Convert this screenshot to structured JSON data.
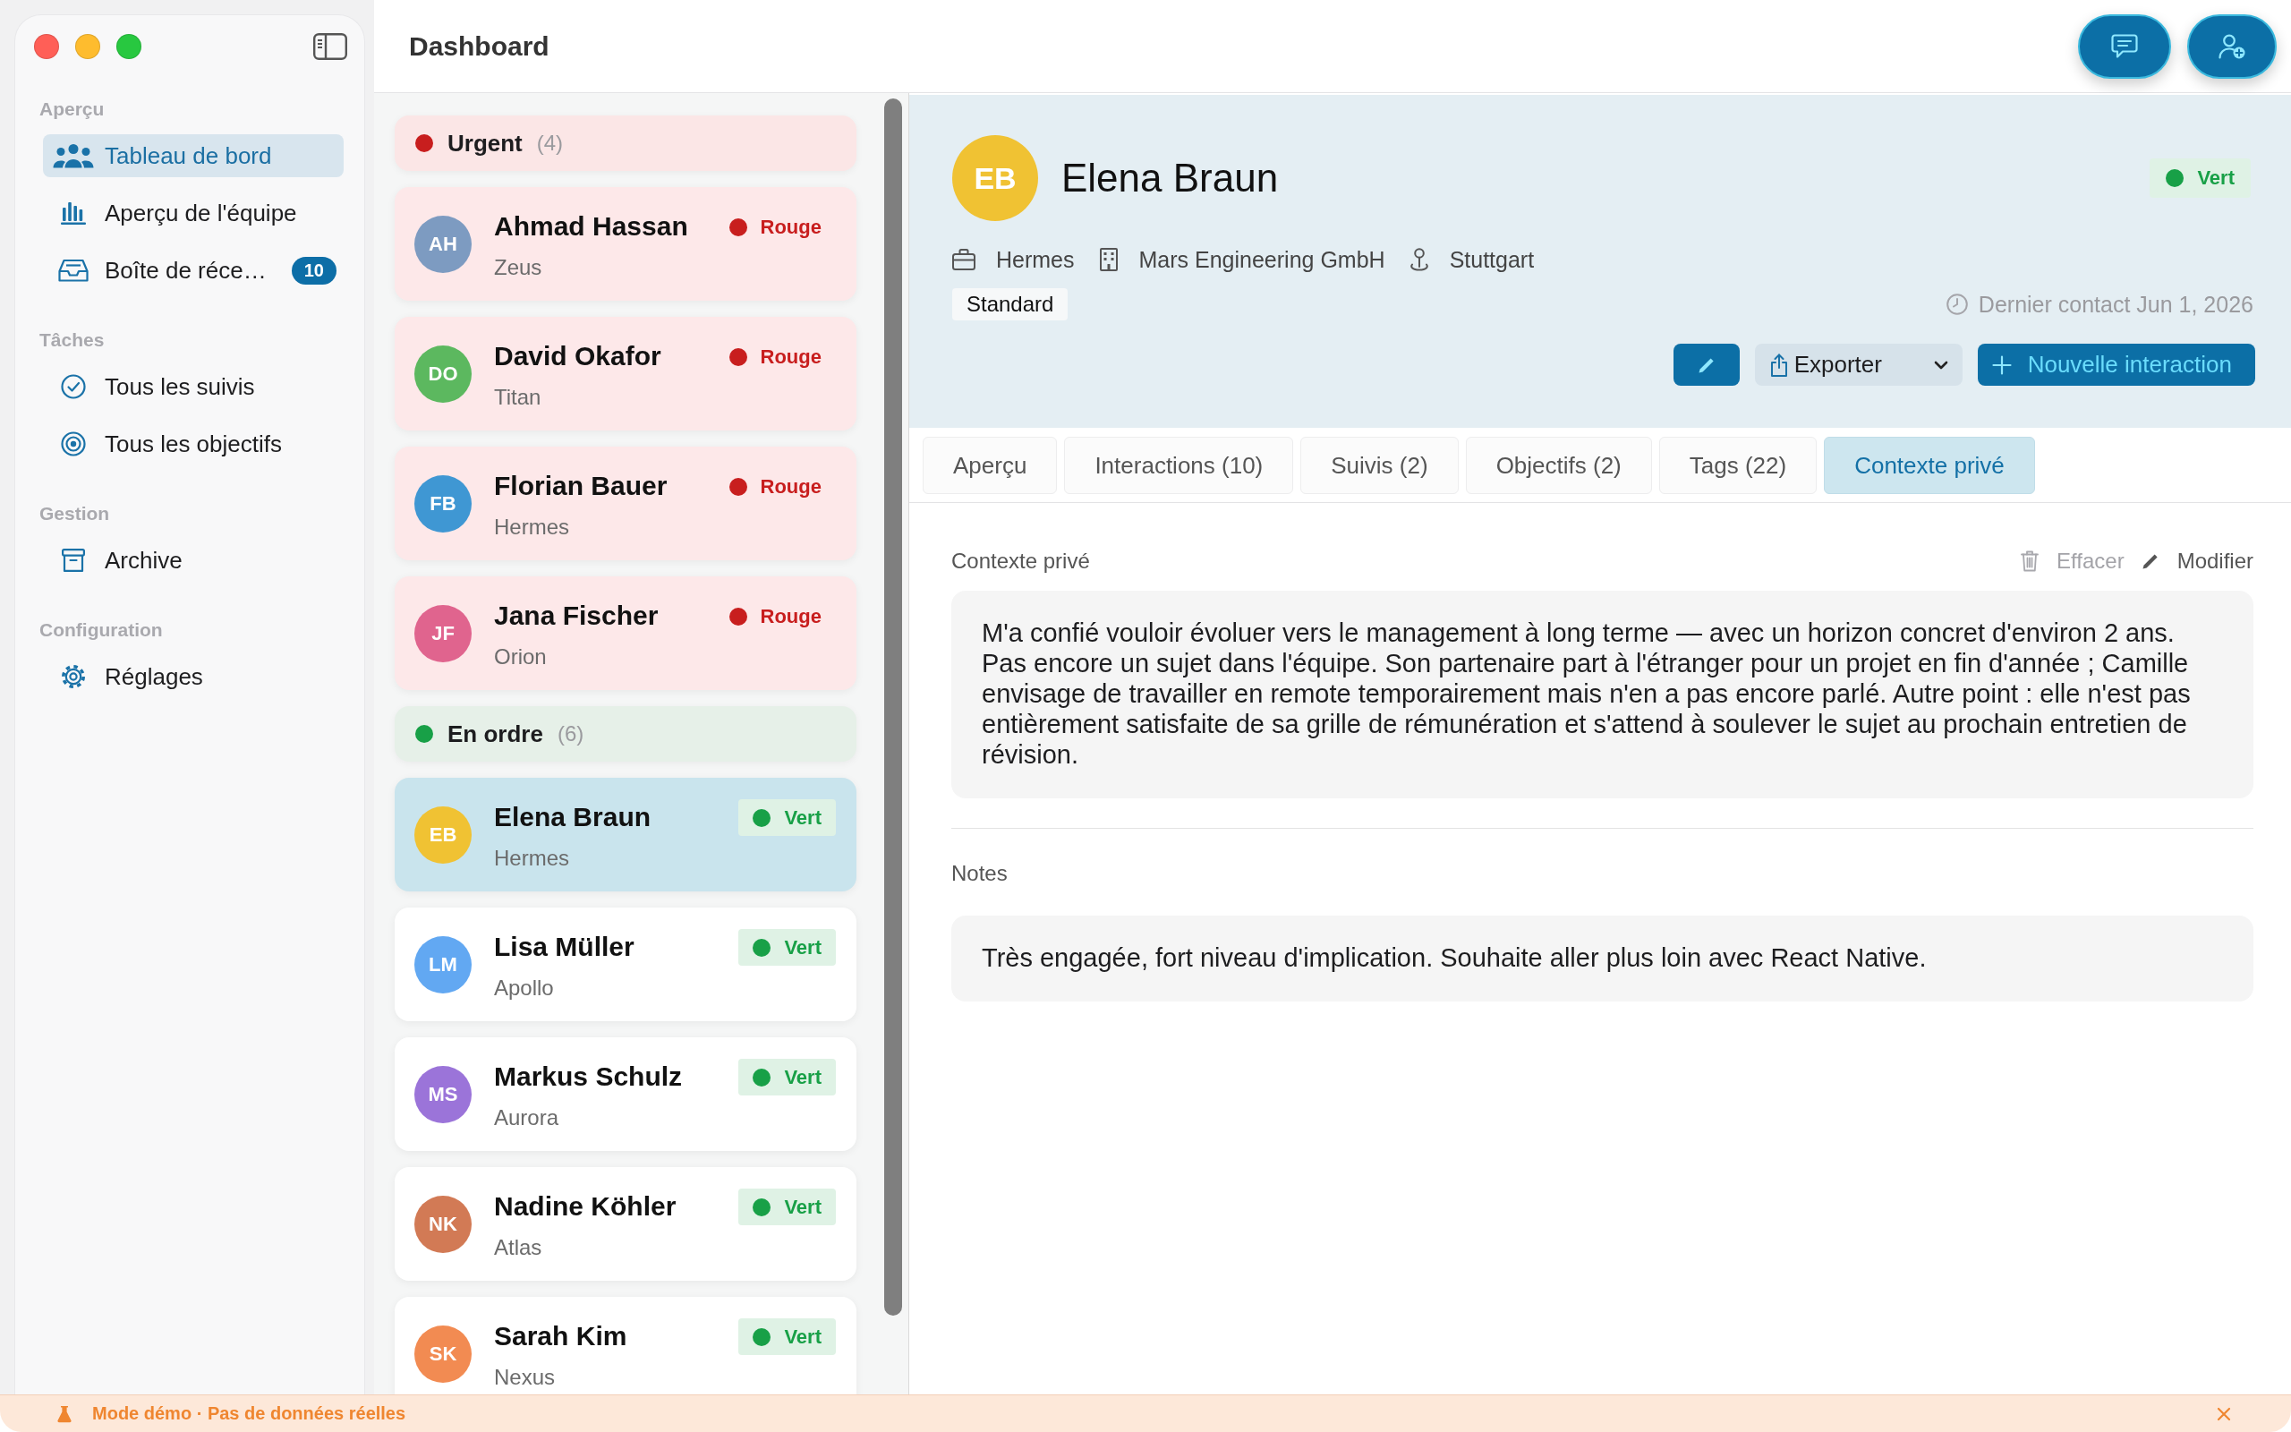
{
  "window": {
    "title": "Dashboard"
  },
  "sidebar": {
    "sections": [
      {
        "title": "Aperçu",
        "items": [
          {
            "label": "Tableau de bord",
            "selected": true
          },
          {
            "label": "Aperçu de l'équipe",
            "selected": false
          },
          {
            "label": "Boîte de réce…",
            "selected": false,
            "badge": "10"
          }
        ]
      },
      {
        "title": "Tâches",
        "items": [
          {
            "label": "Tous les suivis",
            "selected": false
          },
          {
            "label": "Tous les objectifs",
            "selected": false
          }
        ]
      },
      {
        "title": "Gestion",
        "items": [
          {
            "label": "Archive",
            "selected": false
          }
        ]
      },
      {
        "title": "Configuration",
        "items": [
          {
            "label": "Réglages",
            "selected": false
          }
        ]
      }
    ]
  },
  "contact_list": {
    "groups": [
      {
        "kind": "urgent",
        "label": "Urgent",
        "count": "(4)",
        "color": "#c81e1e",
        "contacts": [
          {
            "avatar": {
              "initials": "AH",
              "color": "#7d9bc1"
            },
            "name": "Ahmad Hassan",
            "team": "Zeus",
            "status": {
              "label": "Rouge",
              "color": "#c81e1e"
            },
            "selected": false
          },
          {
            "avatar": {
              "initials": "DO",
              "color": "#5cb85f"
            },
            "name": "David Okafor",
            "team": "Titan",
            "status": {
              "label": "Rouge",
              "color": "#c81e1e"
            },
            "selected": false
          },
          {
            "avatar": {
              "initials": "FB",
              "color": "#3f97d3"
            },
            "name": "Florian Bauer",
            "team": "Hermes",
            "status": {
              "label": "Rouge",
              "color": "#c81e1e"
            },
            "selected": false
          },
          {
            "avatar": {
              "initials": "JF",
              "color": "#e0648e"
            },
            "name": "Jana Fischer",
            "team": "Orion",
            "status": {
              "label": "Rouge",
              "color": "#c81e1e"
            },
            "selected": false
          }
        ]
      },
      {
        "kind": "ok",
        "label": "En ordre",
        "count": "(6)",
        "color": "#18a047",
        "contacts": [
          {
            "avatar": {
              "initials": "EB",
              "color": "#f0c233"
            },
            "name": "Elena Braun",
            "team": "Hermes",
            "status": {
              "label": "Vert",
              "color": "#18a047"
            },
            "selected": true
          },
          {
            "avatar": {
              "initials": "LM",
              "color": "#62a8f2"
            },
            "name": "Lisa Müller",
            "team": "Apollo",
            "status": {
              "label": "Vert",
              "color": "#18a047"
            },
            "selected": false
          },
          {
            "avatar": {
              "initials": "MS",
              "color": "#9b74d9"
            },
            "name": "Markus Schulz",
            "team": "Aurora",
            "status": {
              "label": "Vert",
              "color": "#18a047"
            },
            "selected": false
          },
          {
            "avatar": {
              "initials": "NK",
              "color": "#d27a55"
            },
            "name": "Nadine Köhler",
            "team": "Atlas",
            "status": {
              "label": "Vert",
              "color": "#18a047"
            },
            "selected": false
          },
          {
            "avatar": {
              "initials": "SK",
              "color": "#f28b52"
            },
            "name": "Sarah Kim",
            "team": "Nexus",
            "status": {
              "label": "Vert",
              "color": "#18a047"
            },
            "selected": false
          }
        ]
      }
    ]
  },
  "detail": {
    "avatar": {
      "initials": "EB",
      "color": "#f0c233"
    },
    "name": "Elena Braun",
    "status": {
      "label": "Vert",
      "color": "#18a047"
    },
    "meta": [
      "Hermes",
      "Mars Engineering GmbH",
      "Stuttgart"
    ],
    "tier": "Standard",
    "last_contact": "Dernier contact Jun 1, 2026",
    "export_button": "Exporter",
    "new_interaction_button": "Nouvelle interaction",
    "tabs": [
      {
        "label": "Aperçu",
        "selected": false
      },
      {
        "label": "Interactions (10)",
        "selected": false
      },
      {
        "label": "Suivis (2)",
        "selected": false
      },
      {
        "label": "Objectifs (2)",
        "selected": false
      },
      {
        "label": "Tags (22)",
        "selected": false
      },
      {
        "label": "Contexte privé",
        "selected": true
      }
    ],
    "sections": [
      {
        "title": "Contexte privé",
        "actions": [
          {
            "label": "Effacer",
            "disabled": true
          },
          {
            "label": "Modifier",
            "disabled": false
          }
        ],
        "text": "M'a confié vouloir évoluer vers le management à long terme — avec un horizon concret d'environ 2 ans. Pas encore un sujet dans l'équipe. Son partenaire part à l'étranger pour un projet en fin d'année ; Camille envisage de travailler en remote temporairement mais n'en a pas encore parlé. Autre point : elle n'est pas entièrement satisfaite de sa grille de rémunération et s'attend à soulever le sujet au prochain entretien de révision."
      },
      {
        "title": "Notes",
        "text": "Très engagée, fort niveau d'implication. Souhaite aller plus loin avec React Native."
      }
    ]
  },
  "banner": {
    "text": "Mode démo · Pas de données réelles"
  }
}
